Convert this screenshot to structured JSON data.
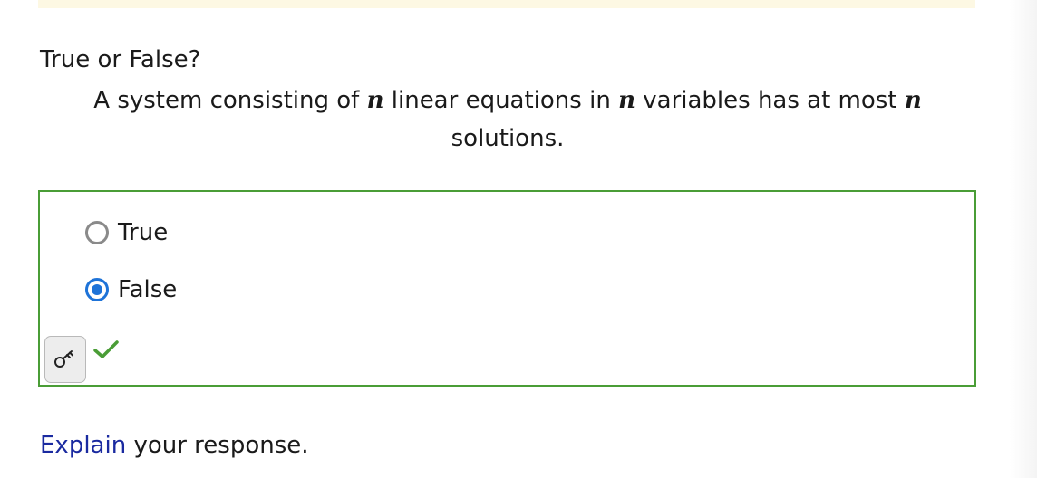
{
  "colors": {
    "accent": "#1e73d8",
    "correct": "#4a9d36",
    "link": "#1a2aa0",
    "banner": "#fdf8e3"
  },
  "question": {
    "label": "True or False?",
    "statement_part1": "A system consisting of ",
    "var1": "n",
    "statement_part2": " linear equations in ",
    "var2": "n",
    "statement_part3": " variables has at most ",
    "var3": "n",
    "statement_part4": " solutions."
  },
  "answer": {
    "options": [
      {
        "label": "True",
        "selected": false
      },
      {
        "label": "False",
        "selected": true
      }
    ],
    "key_icon": "key-icon",
    "status_icon": "checkmark-icon",
    "status": "correct"
  },
  "explain": {
    "link_text": "Explain",
    "rest_text": " your response."
  }
}
